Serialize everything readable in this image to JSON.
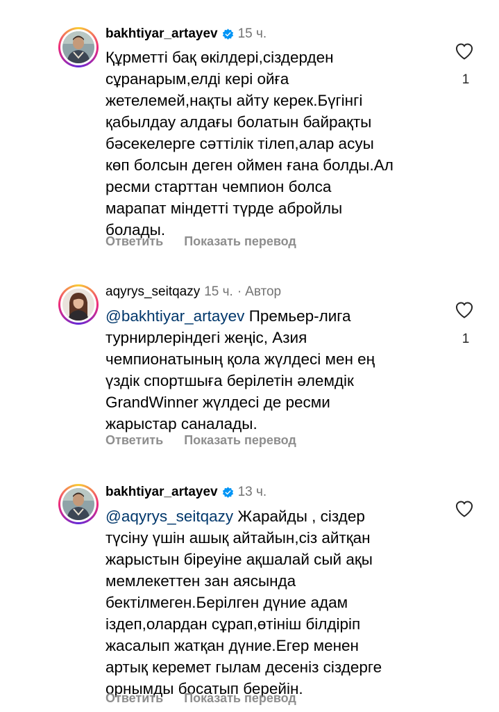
{
  "comments": [
    {
      "username": "bakhtiyar_artayev",
      "verified": true,
      "time": "15 ч.",
      "author_label": "",
      "mention": "",
      "lines": [
        "Құрметті бақ өкілдері,сіздерден",
        "сұранарым,елді кері ойға",
        "жетелемей,нақты айту керек.Бүгінгі",
        "қабылдау алдағы болатын байрақты",
        "бәсекелерге сәттілік тілеп,алар асуы",
        "көп болсын деген оймен ғана болды.Ал",
        "ресми старттан чемпион болса",
        "марапат міндетті түрде абройлы",
        "болады."
      ],
      "reply_label": "Ответить",
      "translate_label": "Показать перевод",
      "likes": "1"
    },
    {
      "username": "aqyrys_seitqazy",
      "verified": false,
      "time": "15 ч.",
      "author_label": "Автор",
      "mention": "@bakhtiyar_artayev",
      "lines": [
        " Премьер-лига",
        "турнирлеріндегі жеңіс, Азия",
        "чемпионатының қола жүлдесі мен ең",
        "үздік спортшыға берілетін әлемдік",
        "GrandWinner жүлдесі де ресми",
        "жарыстар саналады."
      ],
      "reply_label": "Ответить",
      "translate_label": "Показать перевод",
      "likes": "1"
    },
    {
      "username": "bakhtiyar_artayev",
      "verified": true,
      "time": "13 ч.",
      "author_label": "",
      "mention": "@aqyrys_seitqazy",
      "lines": [
        " Жарайды , сіздер",
        "түсіну үшін ашық айтайын,сіз айтқан",
        "жарыстын біреуіне ақшалай сый ақы",
        "мемлекеттен зан аясында",
        "бектілмеген.Берілген дүние адам",
        "іздеп,олардан сұрап,өтініш білдіріп",
        "жасалып жатқан дүние.Егер менен",
        "артық керемет гылам десеніз сіздерге",
        "орнымды босатып берейін."
      ],
      "reply_label": "Ответить",
      "translate_label": "Показать перевод",
      "likes": ""
    }
  ],
  "icons": {
    "heart": "heart-outline-icon",
    "verified": "verified-badge-icon"
  },
  "colors": {
    "text": "#000000",
    "secondary": "#737373",
    "action": "#8e8e8e",
    "mention": "#00376b",
    "verified_blue": "#0095f6"
  }
}
